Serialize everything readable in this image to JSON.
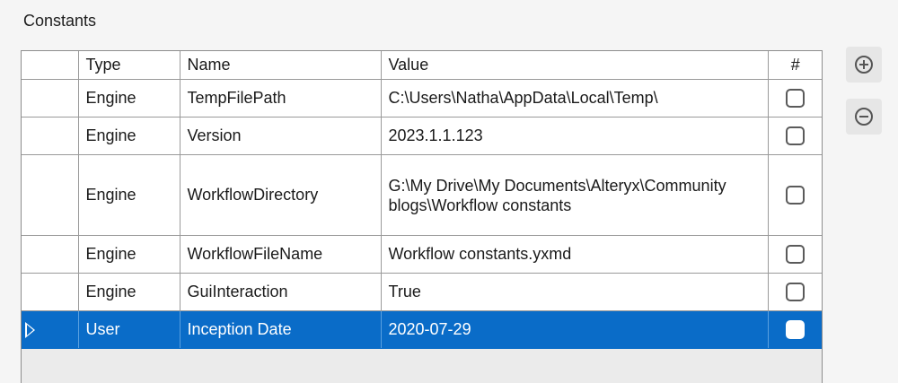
{
  "panel": {
    "title": "Constants"
  },
  "grid": {
    "columns": {
      "type": "Type",
      "name": "Name",
      "value": "Value",
      "hash": "#"
    },
    "rows": [
      {
        "type": "Engine",
        "name": "TempFilePath",
        "value": "C:\\Users\\Natha\\AppData\\Local\\Temp\\",
        "numeric": false,
        "selected": false
      },
      {
        "type": "Engine",
        "name": "Version",
        "value": "2023.1.1.123",
        "numeric": false,
        "selected": false
      },
      {
        "type": "Engine",
        "name": "WorkflowDirectory",
        "value": "G:\\My Drive\\My Documents\\Alteryx\\Community blogs\\Workflow constants",
        "numeric": false,
        "selected": false
      },
      {
        "type": "Engine",
        "name": "WorkflowFileName",
        "value": "Workflow constants.yxmd",
        "numeric": false,
        "selected": false
      },
      {
        "type": "Engine",
        "name": "GuiInteraction",
        "value": "True",
        "numeric": false,
        "selected": false
      },
      {
        "type": "User",
        "name": "Inception Date",
        "value": "2020-07-29",
        "numeric": false,
        "selected": true
      }
    ]
  },
  "buttons": {
    "add_icon": "plus-circle-icon",
    "remove_icon": "minus-circle-icon"
  },
  "colors": {
    "selection": "#0a6cc8"
  }
}
